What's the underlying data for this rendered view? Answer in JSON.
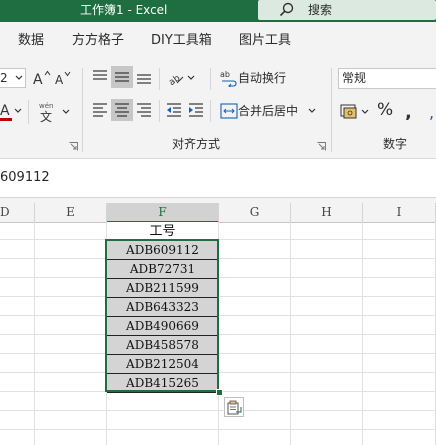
{
  "titlebar": {
    "title": "工作簿1  -  Excel",
    "search_label": "搜索"
  },
  "menu": {
    "tabs": [
      "数据",
      "方方格子",
      "DIY工具箱",
      "图片工具"
    ]
  },
  "ribbon": {
    "font_size_value": "2",
    "wrap_text_label": "自动换行",
    "merge_center_label": "合并后居中",
    "alignment_group_label": "对齐方式",
    "number_format_value": "常规",
    "number_group_label": "数字",
    "percent_symbol": "%",
    "font_color": "#c00000"
  },
  "formula_bar": {
    "value": "609112"
  },
  "columns": [
    "D",
    "E",
    "F",
    "G",
    "H",
    "I"
  ],
  "sheet": {
    "header_cell": "工号",
    "values": [
      "ADB609112",
      "ADB72731",
      "ADB211599",
      "ADB643323",
      "ADB490669",
      "ADB458578",
      "ADB212504",
      "ADB415265"
    ]
  },
  "colors": {
    "accent": "#1e6e41",
    "selection_fill": "#d4d4d4"
  }
}
